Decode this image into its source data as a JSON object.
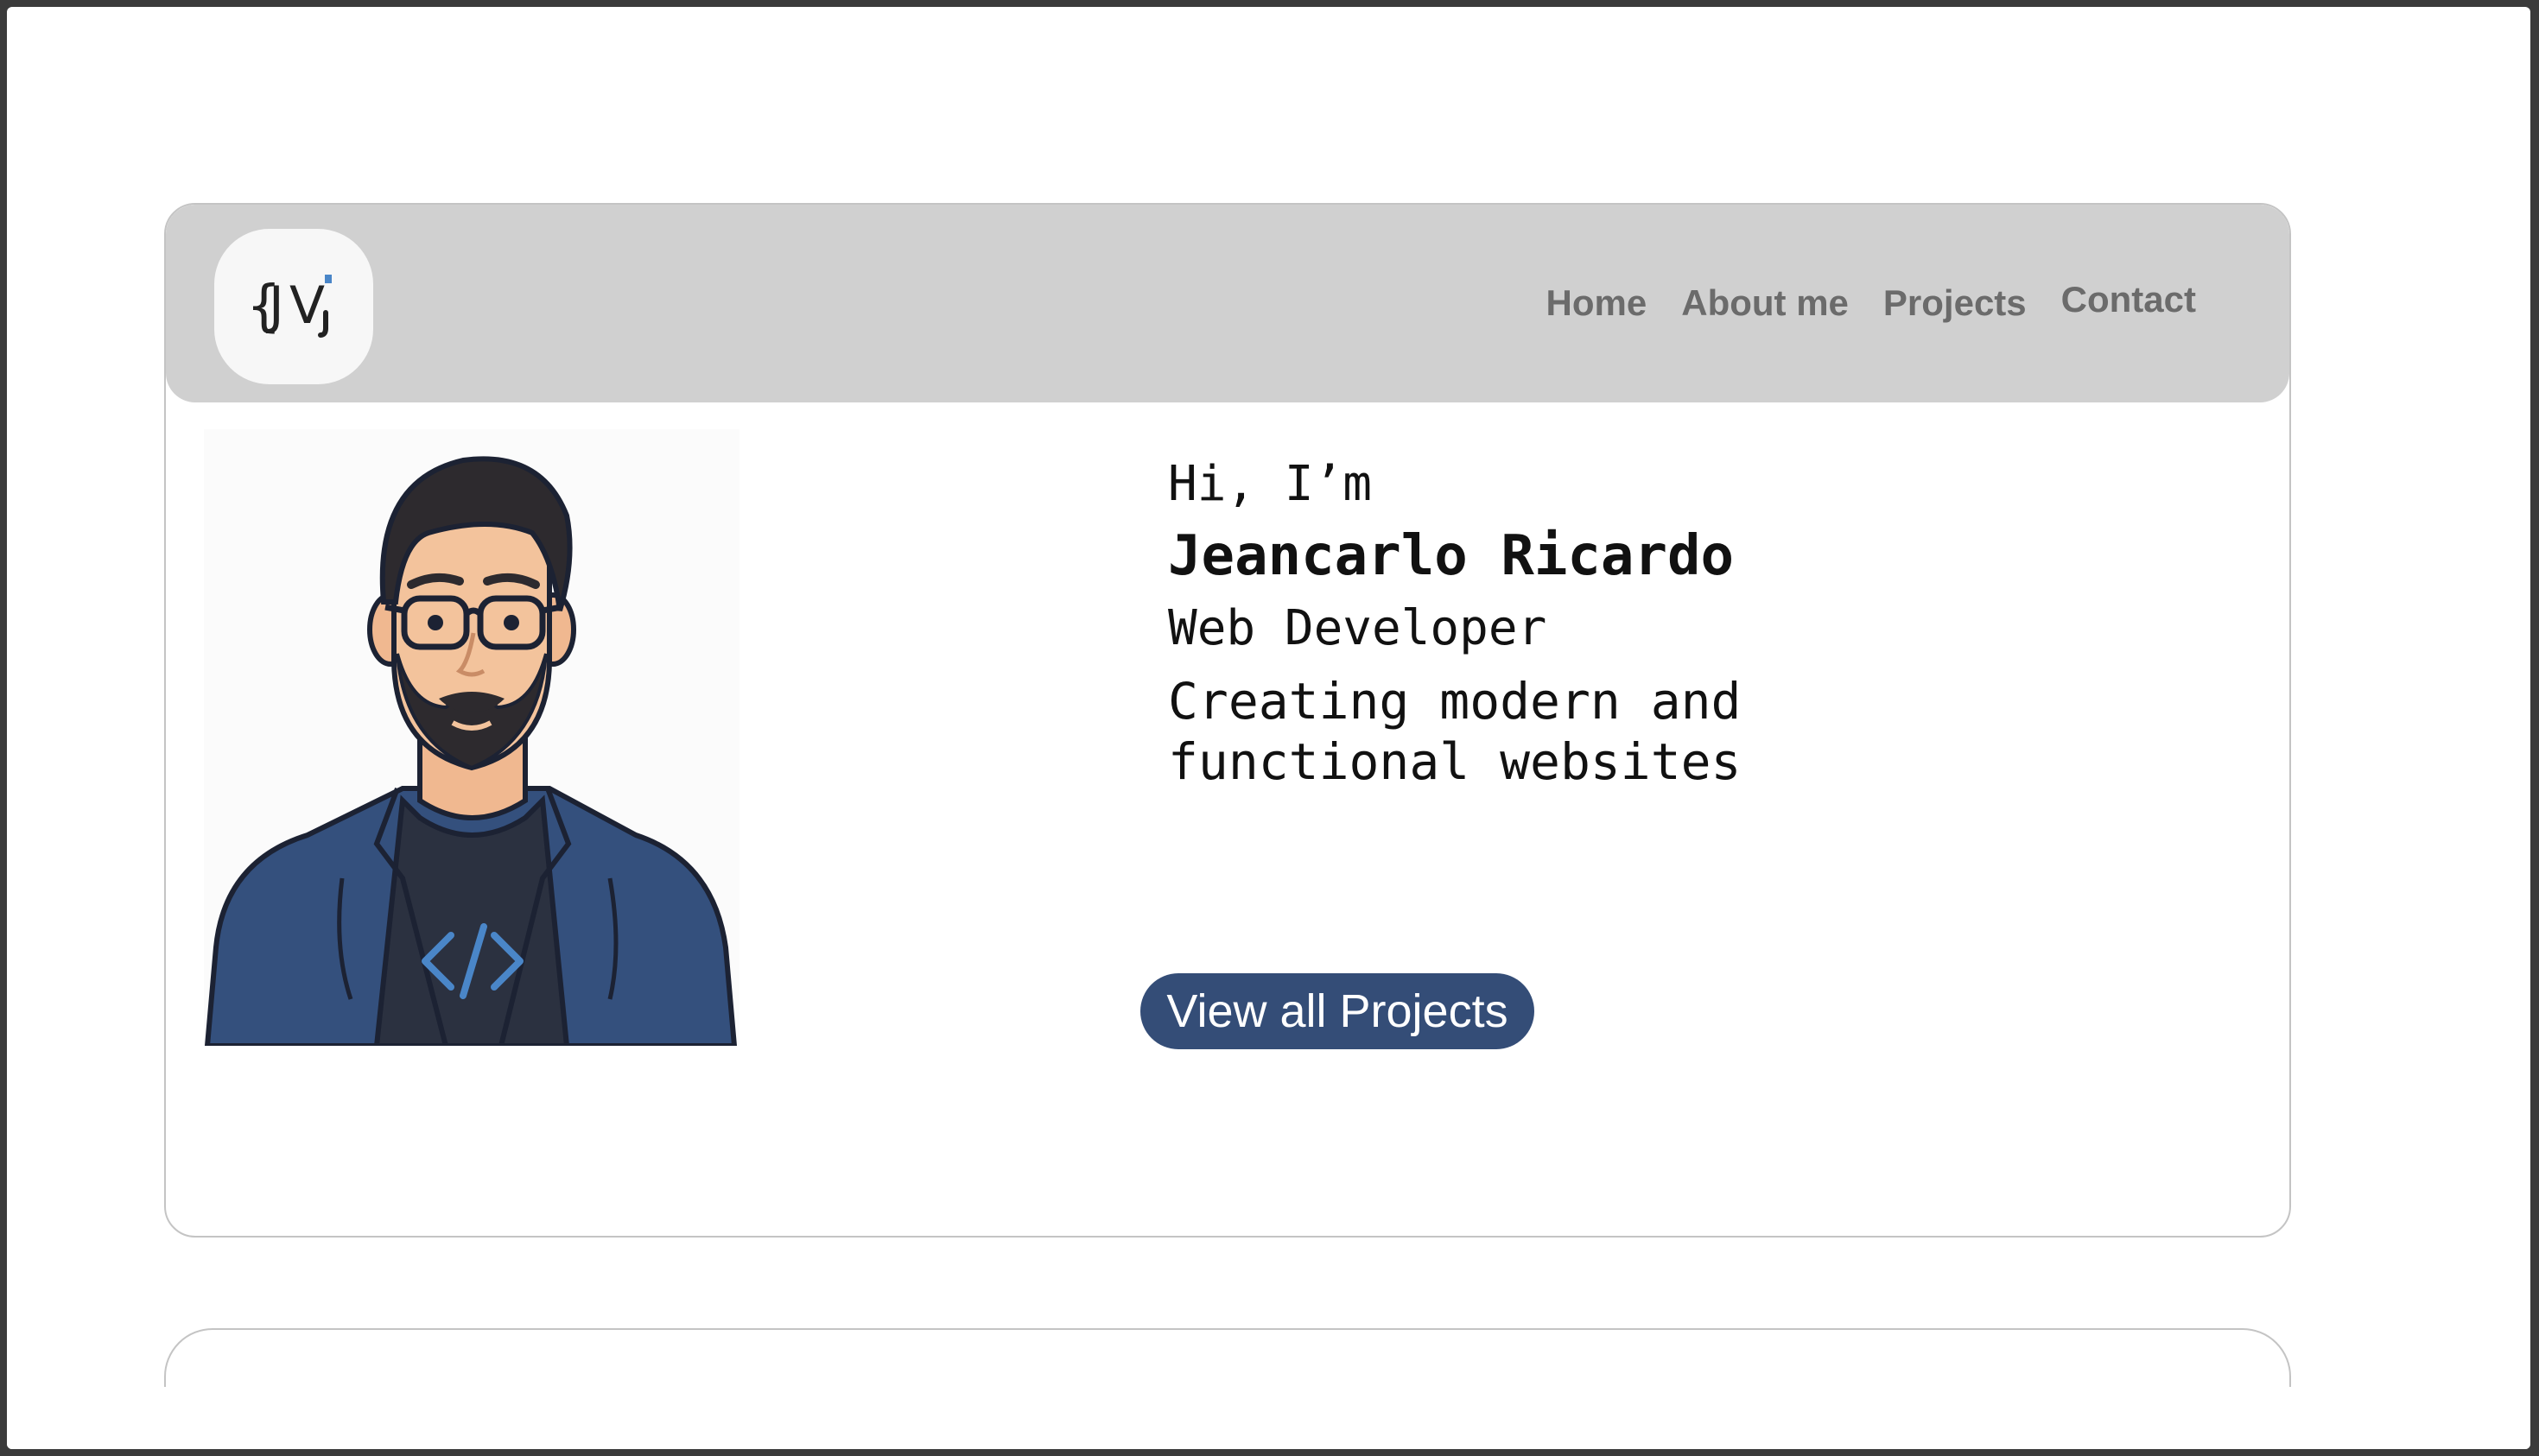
{
  "logo": {
    "text": "{JV}"
  },
  "nav": {
    "items": [
      {
        "label": "Home"
      },
      {
        "label": "About me"
      },
      {
        "label": "Projects"
      },
      {
        "label": "Contact"
      }
    ]
  },
  "hero": {
    "greeting": "Hi, I’m",
    "name": "Jeancarlo Ricardo",
    "role": "Web Developer",
    "tagline": "Creating modern and functional websites",
    "cta_label": "View all Projects"
  },
  "colors": {
    "navbar_bg": "#d0d0d0",
    "cta_bg": "#344d77",
    "nav_text": "#6b6b6b",
    "jacket": "#34507d",
    "code_icon": "#4a86c8"
  },
  "icons": [
    "logo-icon",
    "developer-avatar",
    "code-brackets-icon"
  ]
}
